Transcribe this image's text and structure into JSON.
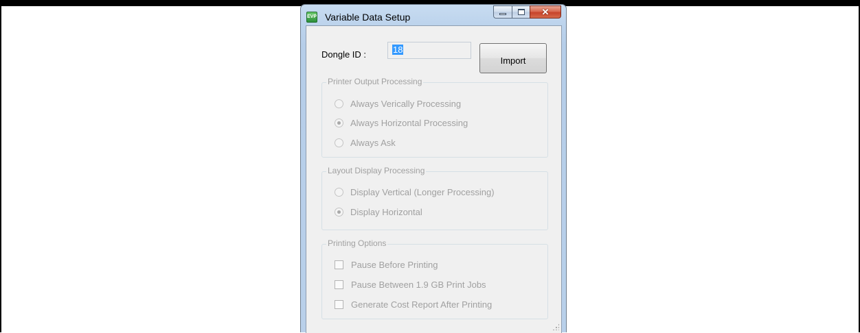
{
  "window": {
    "title": "Variable Data Setup",
    "icon_text": "EVP",
    "caption": {
      "minimize": "minimize-icon",
      "maximize": "maximize-icon",
      "close": "✕"
    }
  },
  "dongle": {
    "label": "Dongle ID :",
    "value": "18"
  },
  "import_button": "Import",
  "printer_output": {
    "title": "Printer Output Processing",
    "options": [
      {
        "label": "Always Verically Processing",
        "selected": false
      },
      {
        "label": "Always Horizontal Processing",
        "selected": true
      },
      {
        "label": "Always Ask",
        "selected": false
      }
    ]
  },
  "layout_display": {
    "title": "Layout Display Processing",
    "options": [
      {
        "label": "Display Vertical (Longer Processing)",
        "selected": false
      },
      {
        "label": "Display Horizontal",
        "selected": true
      }
    ]
  },
  "printing_options": {
    "title": "Printing Options",
    "options": [
      {
        "label": "Pause Before Printing",
        "checked": false
      },
      {
        "label": "Pause Between 1.9 GB Print Jobs",
        "checked": false
      },
      {
        "label": "Generate Cost Report After Printing",
        "checked": false
      }
    ]
  },
  "colors": {
    "selection": "#3399ff",
    "disabled_text": "#a0a0a0",
    "frame": "#b9d0ea"
  }
}
